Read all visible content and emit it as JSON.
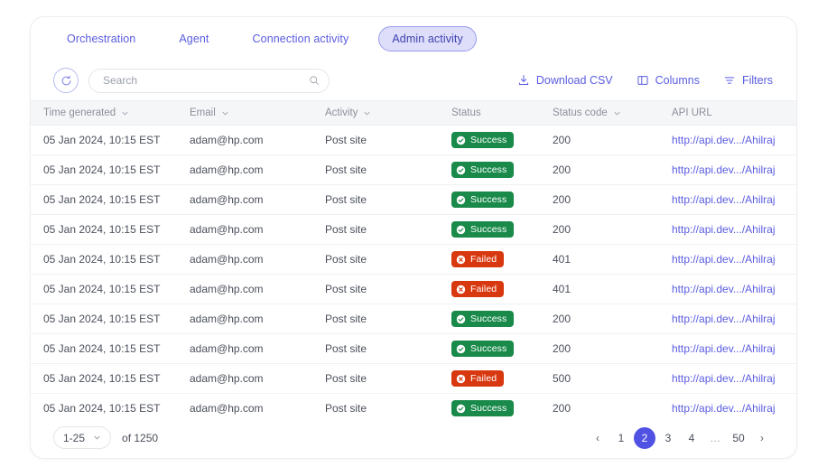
{
  "tabs": [
    {
      "label": "Orchestration",
      "active": false
    },
    {
      "label": "Agent",
      "active": false
    },
    {
      "label": "Connection activity",
      "active": false
    },
    {
      "label": "Admin activity",
      "active": true
    }
  ],
  "toolbar": {
    "refresh_icon": "refresh-icon",
    "search": {
      "placeholder": "Search",
      "value": "",
      "icon": "search-icon"
    },
    "download_csv": "Download CSV",
    "columns": "Columns",
    "filters": "Filters"
  },
  "table": {
    "columns": [
      {
        "label": "Time generated",
        "sortable": true
      },
      {
        "label": "Email",
        "sortable": true
      },
      {
        "label": "Activity",
        "sortable": true
      },
      {
        "label": "Status",
        "sortable": false
      },
      {
        "label": "Status code",
        "sortable": true
      },
      {
        "label": "API URL",
        "sortable": false
      }
    ],
    "rows": [
      {
        "time": "05 Jan 2024, 10:15 EST",
        "email": "adam@hp.com",
        "activity": "Post site",
        "status": "Success",
        "status_kind": "success",
        "code": "200",
        "url": "http://api.dev.../Ahilraj"
      },
      {
        "time": "05 Jan 2024, 10:15 EST",
        "email": "adam@hp.com",
        "activity": "Post site",
        "status": "Success",
        "status_kind": "success",
        "code": "200",
        "url": "http://api.dev.../Ahilraj"
      },
      {
        "time": "05 Jan 2024, 10:15 EST",
        "email": "adam@hp.com",
        "activity": "Post site",
        "status": "Success",
        "status_kind": "success",
        "code": "200",
        "url": "http://api.dev.../Ahilraj"
      },
      {
        "time": "05 Jan 2024, 10:15 EST",
        "email": "adam@hp.com",
        "activity": "Post site",
        "status": "Success",
        "status_kind": "success",
        "code": "200",
        "url": "http://api.dev.../Ahilraj"
      },
      {
        "time": "05 Jan 2024, 10:15 EST",
        "email": "adam@hp.com",
        "activity": "Post site",
        "status": "Failed",
        "status_kind": "failed",
        "code": "401",
        "url": "http://api.dev.../Ahilraj"
      },
      {
        "time": "05 Jan 2024, 10:15 EST",
        "email": "adam@hp.com",
        "activity": "Post site",
        "status": "Failed",
        "status_kind": "failed",
        "code": "401",
        "url": "http://api.dev.../Ahilraj"
      },
      {
        "time": "05 Jan 2024, 10:15 EST",
        "email": "adam@hp.com",
        "activity": "Post site",
        "status": "Success",
        "status_kind": "success",
        "code": "200",
        "url": "http://api.dev.../Ahilraj"
      },
      {
        "time": "05 Jan 2024, 10:15 EST",
        "email": "adam@hp.com",
        "activity": "Post site",
        "status": "Success",
        "status_kind": "success",
        "code": "200",
        "url": "http://api.dev.../Ahilraj"
      },
      {
        "time": "05 Jan 2024, 10:15 EST",
        "email": "adam@hp.com",
        "activity": "Post site",
        "status": "Failed",
        "status_kind": "failed",
        "code": "500",
        "url": "http://api.dev.../Ahilraj"
      },
      {
        "time": "05 Jan 2024, 10:15 EST",
        "email": "adam@hp.com",
        "activity": "Post site",
        "status": "Success",
        "status_kind": "success",
        "code": "200",
        "url": "http://api.dev.../Ahilraj"
      }
    ]
  },
  "footer": {
    "rows_per_page": "1-25",
    "total_label": "of 1250",
    "pages": [
      {
        "label": "‹",
        "kind": "arrow",
        "name": "prev-page-button"
      },
      {
        "label": "1",
        "kind": "page",
        "name": "page-1-button"
      },
      {
        "label": "2",
        "kind": "active",
        "name": "page-2-button"
      },
      {
        "label": "3",
        "kind": "page",
        "name": "page-3-button"
      },
      {
        "label": "4",
        "kind": "page",
        "name": "page-4-button"
      },
      {
        "label": "…",
        "kind": "ellipsis",
        "name": "page-ellipsis"
      },
      {
        "label": "50",
        "kind": "page",
        "name": "page-50-button"
      },
      {
        "label": "›",
        "kind": "arrow",
        "name": "next-page-button"
      }
    ]
  },
  "colors": {
    "accent": "#5a5ce0",
    "active_page": "#4f52e3",
    "tab_active_bg": "#dedefa",
    "success": "#1a8a4a",
    "failed": "#d8380f",
    "header_bg": "#f5f6f8"
  }
}
